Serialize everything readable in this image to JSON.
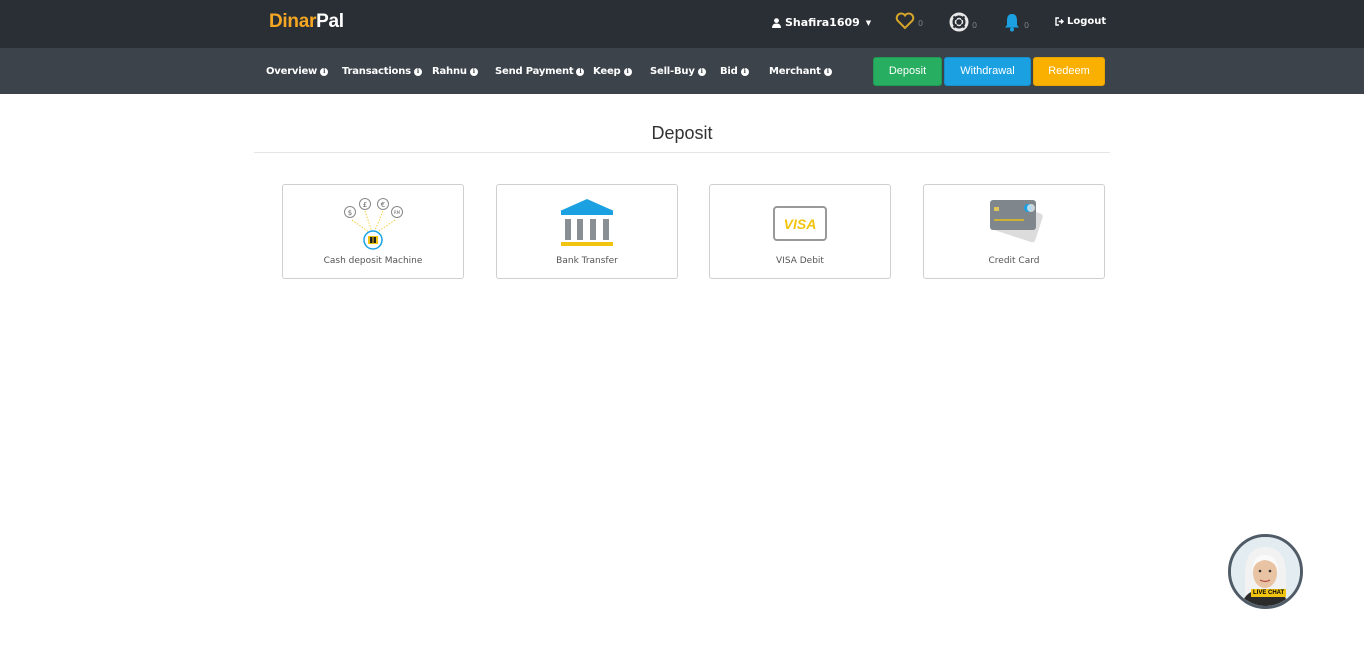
{
  "brand": {
    "part1": "Dinar",
    "part2": "Pal"
  },
  "topbar": {
    "username": "Shafira1609",
    "favorites_count": "0",
    "support_count": "0",
    "notifications_count": "0",
    "logout_label": "Logout"
  },
  "nav": {
    "items": [
      {
        "label": "Overview"
      },
      {
        "label": "Transactions"
      },
      {
        "label": "Rahnu"
      },
      {
        "label": "Send Payment"
      },
      {
        "label": "Keep"
      },
      {
        "label": "Sell-Buy"
      },
      {
        "label": "Bid"
      },
      {
        "label": "Merchant"
      }
    ],
    "deposit_label": "Deposit",
    "withdrawal_label": "Withdrawal",
    "redeem_label": "Redeem"
  },
  "main": {
    "title": "Deposit",
    "methods": [
      {
        "label": "Cash deposit Machine",
        "icon": "cash-deposit-machine-icon"
      },
      {
        "label": "Bank Transfer",
        "icon": "bank-icon"
      },
      {
        "label": "VISA Debit",
        "icon": "visa-card-icon",
        "card_text": "VISA"
      },
      {
        "label": "Credit Card",
        "icon": "credit-card-icon"
      }
    ]
  },
  "livechat": {
    "label": "LIVE CHAT"
  },
  "colors": {
    "topbar": "#2a2f35",
    "navbar": "#3c434b",
    "brand_accent": "#f5a623",
    "deposit": "#27ae60",
    "withdrawal": "#1ba1e2",
    "redeem": "#f9b000"
  }
}
